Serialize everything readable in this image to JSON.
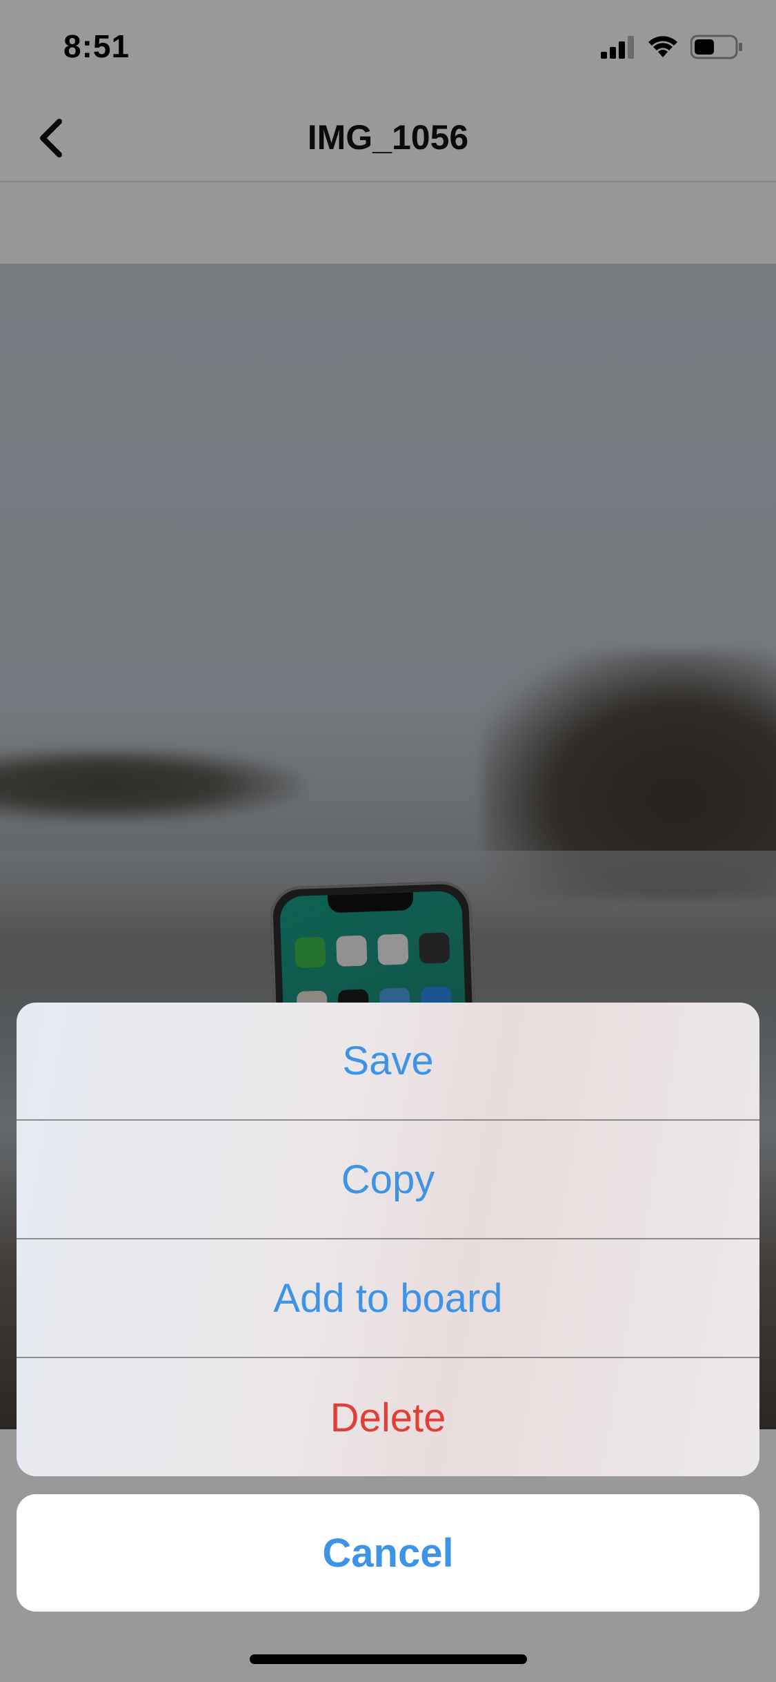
{
  "status_bar": {
    "time": "8:51",
    "icons": [
      "signal-icon",
      "wifi-icon",
      "battery-icon"
    ],
    "battery_level": 0.45
  },
  "nav": {
    "title": "IMG_1056",
    "back_icon": "chevron-left-icon"
  },
  "action_sheet": {
    "items": [
      {
        "label": "Save",
        "color": "#3d94e6"
      },
      {
        "label": "Copy",
        "color": "#3d94e6"
      },
      {
        "label": "Add to board",
        "color": "#3d94e6"
      },
      {
        "label": "Delete",
        "color": "#e33e36"
      }
    ],
    "cancel_label": "Cancel"
  },
  "colors": {
    "accent": "#3d94e6",
    "destructive": "#e33e36"
  }
}
